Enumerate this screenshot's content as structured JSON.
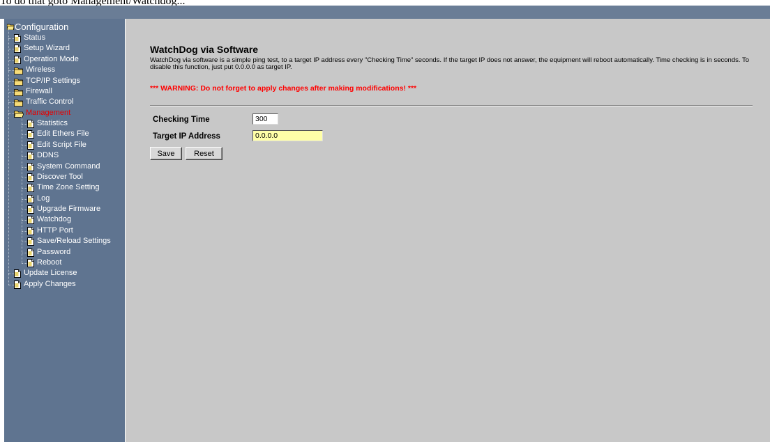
{
  "caption": "To do that goto Management/Watchdog...",
  "tree": {
    "root_label": "Configuration",
    "items": [
      {
        "label": "Status",
        "type": "doc",
        "level": 1
      },
      {
        "label": "Setup Wizard",
        "type": "doc",
        "level": 1
      },
      {
        "label": "Operation Mode",
        "type": "doc",
        "level": 1
      },
      {
        "label": "Wireless",
        "type": "folder",
        "level": 1
      },
      {
        "label": "TCP/IP Settings",
        "type": "folder",
        "level": 1
      },
      {
        "label": "Firewall",
        "type": "folder",
        "level": 1
      },
      {
        "label": "Traffic Control",
        "type": "folder",
        "level": 1
      },
      {
        "label": "Management",
        "type": "folder-open",
        "level": 1,
        "active": true
      },
      {
        "label": "Statistics",
        "type": "doc",
        "level": 2
      },
      {
        "label": "Edit Ethers File",
        "type": "doc",
        "level": 2
      },
      {
        "label": "Edit Script File",
        "type": "doc",
        "level": 2
      },
      {
        "label": "DDNS",
        "type": "doc",
        "level": 2
      },
      {
        "label": "System Command",
        "type": "doc",
        "level": 2
      },
      {
        "label": "Discover Tool",
        "type": "doc",
        "level": 2
      },
      {
        "label": "Time Zone Setting",
        "type": "doc",
        "level": 2
      },
      {
        "label": "Log",
        "type": "doc",
        "level": 2
      },
      {
        "label": "Upgrade Firmware",
        "type": "doc",
        "level": 2
      },
      {
        "label": "Watchdog",
        "type": "doc",
        "level": 2
      },
      {
        "label": "HTTP Port",
        "type": "doc",
        "level": 2
      },
      {
        "label": "Save/Reload Settings",
        "type": "doc",
        "level": 2
      },
      {
        "label": "Password",
        "type": "doc",
        "level": 2
      },
      {
        "label": "Reboot",
        "type": "doc",
        "level": 2
      },
      {
        "label": "Update License",
        "type": "doc",
        "level": 1
      },
      {
        "label": "Apply Changes",
        "type": "doc",
        "level": 1
      }
    ]
  },
  "main": {
    "title": "WatchDog via Software",
    "description": "WatchDog via software is a simple ping test, to a target IP address every \"Checking Time\" seconds. If the target IP does not answer, the equipment will reboot automatically. Time checking is in seconds. To disable this function, just put 0.0.0.0 as target IP.",
    "warning": "*** WARNING: Do not forget to apply changes after making modifications! ***",
    "fields": {
      "checking_time_label": "Checking Time",
      "checking_time_value": "300",
      "target_ip_label": "Target IP Address",
      "target_ip_value": "0.0.0.0"
    },
    "buttons": {
      "save": "Save",
      "reset": "Reset"
    }
  },
  "colors": {
    "sidebar_bg": "#5f7490",
    "topbar_bg": "#6a7d96",
    "content_bg": "#c8c8c8",
    "active_item": "#e60000",
    "warning": "#ff0000",
    "highlight_input": "#ffffa8"
  }
}
